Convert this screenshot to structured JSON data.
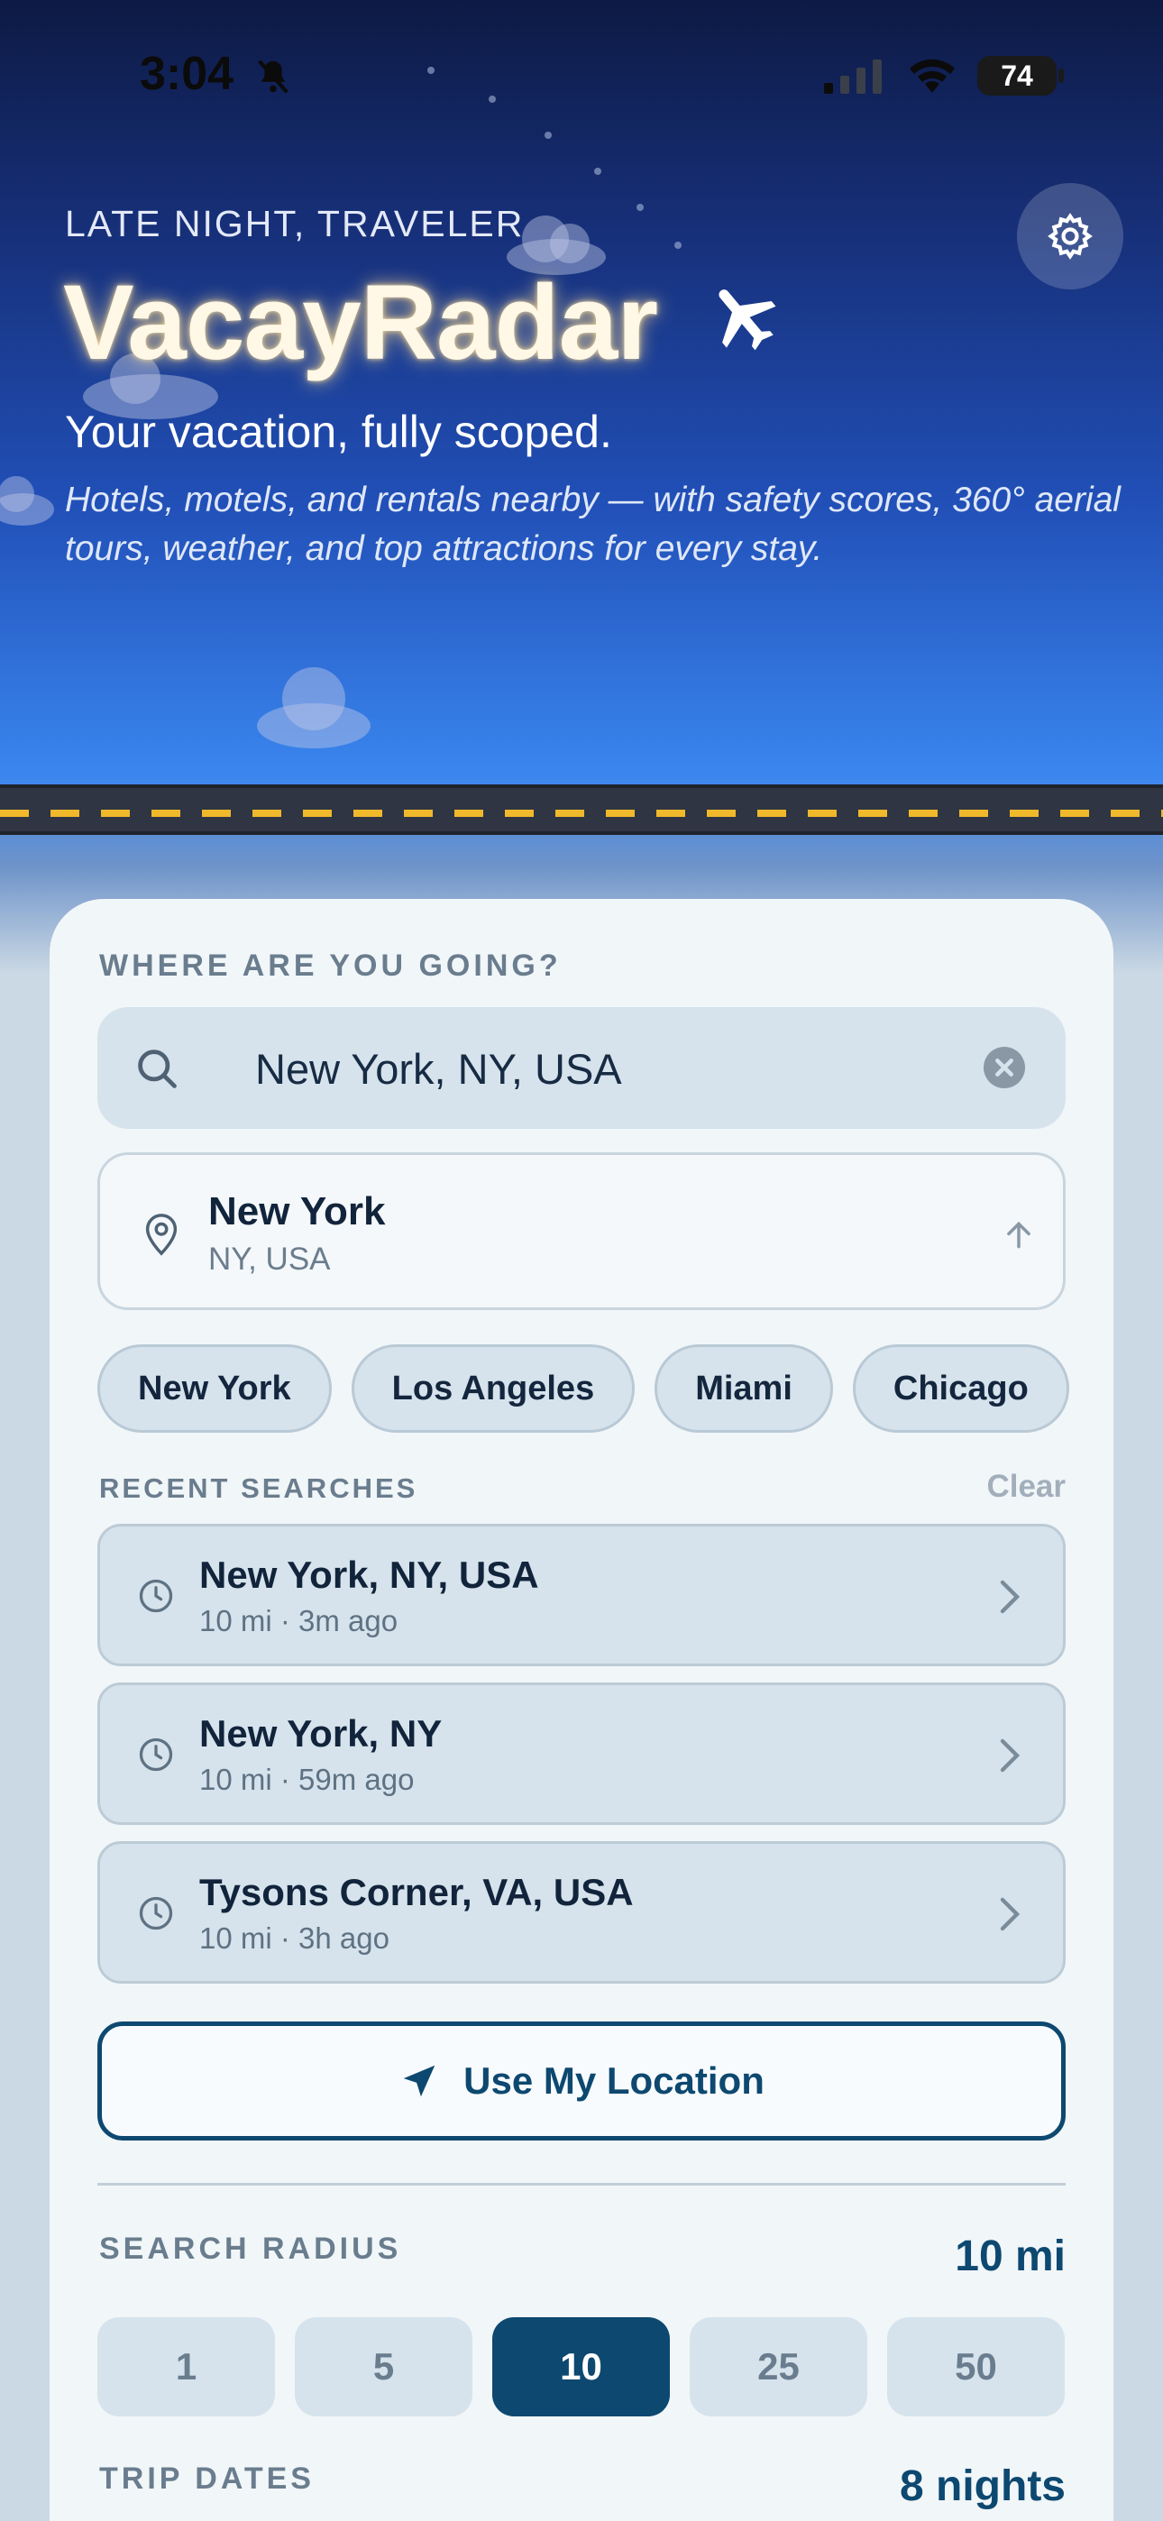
{
  "status_bar": {
    "time": "3:04",
    "battery": "74"
  },
  "hero": {
    "greeting": "LATE NIGHT, TRAVELER",
    "app_title": "VacayRadar",
    "tagline": "Your vacation, fully scoped.",
    "description": "Hotels, motels, and rentals nearby — with safety scores, 360° aerial tours, weather, and top attractions for every stay."
  },
  "search": {
    "section_label": "WHERE ARE YOU GOING?",
    "value": "New York, NY, USA",
    "suggestion": {
      "title": "New York",
      "subtitle": "NY, USA"
    }
  },
  "quick_cities": [
    "New York",
    "Los Angeles",
    "Miami",
    "Chicago"
  ],
  "recent": {
    "section_label": "RECENT SEARCHES",
    "clear_label": "Clear",
    "items": [
      {
        "title": "New York, NY, USA",
        "meta": "10 mi · 3m ago"
      },
      {
        "title": "New York, NY",
        "meta": "10 mi · 59m ago"
      },
      {
        "title": "Tysons Corner, VA, USA",
        "meta": "10 mi · 3h ago"
      }
    ]
  },
  "use_location_label": "Use My Location",
  "radius": {
    "section_label": "SEARCH RADIUS",
    "value_label": "10 mi",
    "options": [
      "1",
      "5",
      "10",
      "25",
      "50"
    ],
    "selected": "10"
  },
  "trip_dates": {
    "section_label": "TRIP DATES",
    "nights_label": "8 nights"
  },
  "colors": {
    "accent": "#0d4870",
    "road_dash": "#f0b92b",
    "card_bg": "#f1f6f9"
  }
}
